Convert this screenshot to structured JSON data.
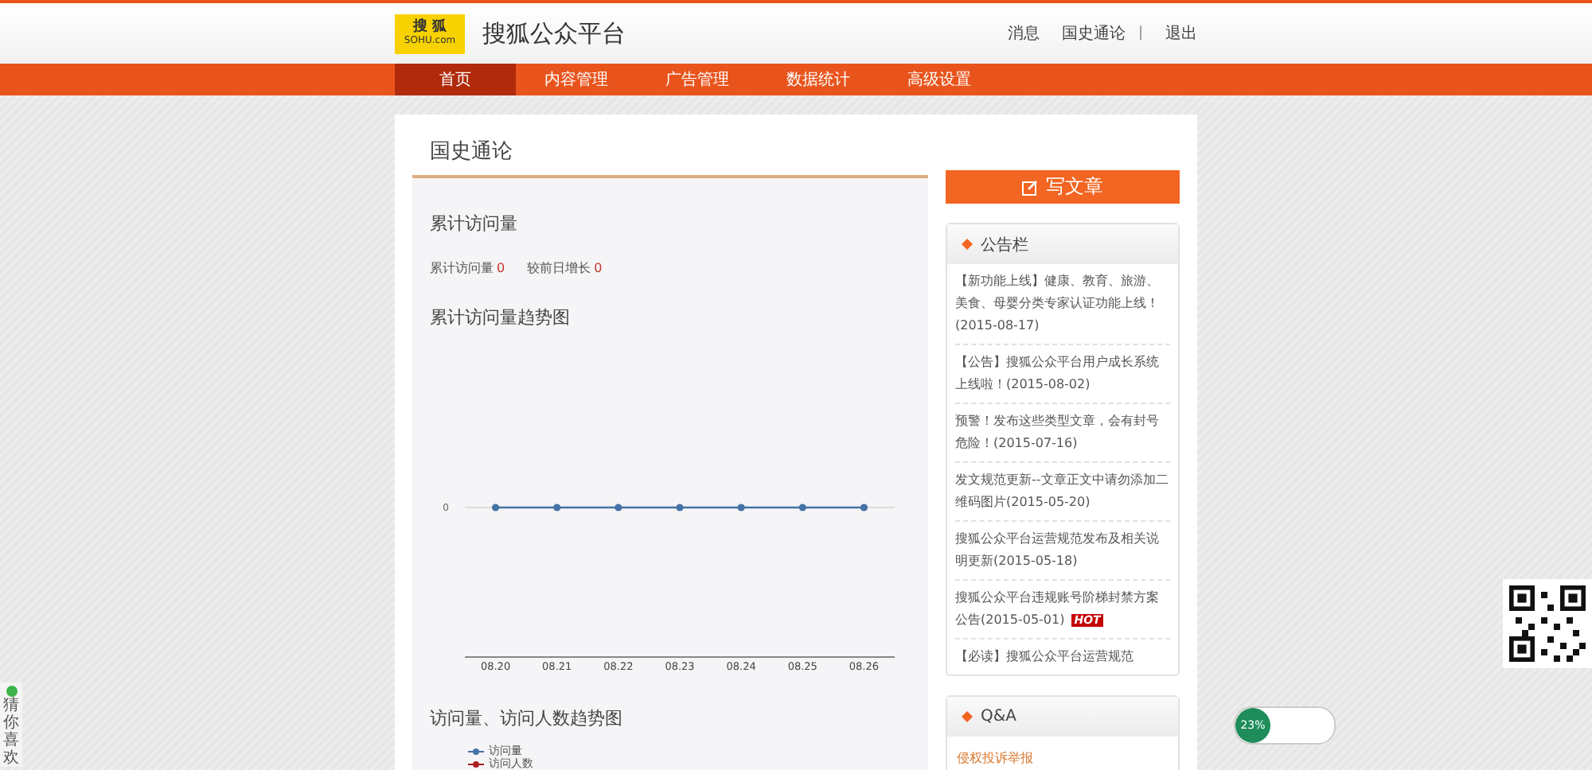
{
  "header": {
    "logo": {
      "name": "搜 狐",
      "domain": "SOHU.com"
    },
    "site_title": "搜狐公众平台",
    "user_links": [
      {
        "label": "消息"
      },
      {
        "label": "国史通论"
      },
      {
        "label": "退出"
      }
    ],
    "separator": "|"
  },
  "nav": [
    {
      "label": "首页",
      "selected": true
    },
    {
      "label": "内容管理",
      "selected": false
    },
    {
      "label": "广告管理",
      "selected": false
    },
    {
      "label": "数据统计",
      "selected": false
    },
    {
      "label": "高级设置",
      "selected": false
    }
  ],
  "main": {
    "title": "国史通论",
    "stats": {
      "heading": "累计访问量",
      "items": [
        {
          "label": "累计访问量",
          "value": "0"
        },
        {
          "label": "较前日增长",
          "value": "0"
        }
      ]
    },
    "trend": {
      "title": "累计访问量趋势图",
      "x_labels": [
        "08.20",
        "08.21",
        "08.22",
        "08.23",
        "08.24",
        "08.25",
        "08.26"
      ],
      "zero_label": "0"
    },
    "visitors": {
      "title": "访问量、访问人数趋势图",
      "legend": [
        {
          "name": "访问量",
          "color": "#4572a7"
        },
        {
          "name": "访问人数",
          "color": "#aa1f1f"
        }
      ]
    }
  },
  "sidebar": {
    "write_button": "写文章",
    "notices": {
      "title": "公告栏",
      "items": [
        {
          "text": "【新功能上线】健康、教育、旅游、美食、母婴分类专家认证功能上线！(2015-08-17)"
        },
        {
          "text": "【公告】搜狐公众平台用户成长系统上线啦！(2015-08-02)"
        },
        {
          "text": "预警！发布这些类型文章，会有封号危险！(2015-07-16)"
        },
        {
          "text": "发文规范更新--文章正文中请勿添加二维码图片(2015-05-20)"
        },
        {
          "text": "搜狐公众平台运营规范发布及相关说明更新(2015-05-18)"
        },
        {
          "text": "搜狐公众平台违规账号阶梯封禁方案公告(2015-05-01)",
          "badge": "HOT"
        },
        {
          "text": "【必读】搜狐公众平台运营规范"
        }
      ]
    },
    "qa": {
      "title": "Q&A",
      "links": [
        "侵权投诉举报"
      ]
    }
  },
  "side_tab": "猜你喜欢",
  "speed_widget": {
    "percent": "23%"
  }
}
